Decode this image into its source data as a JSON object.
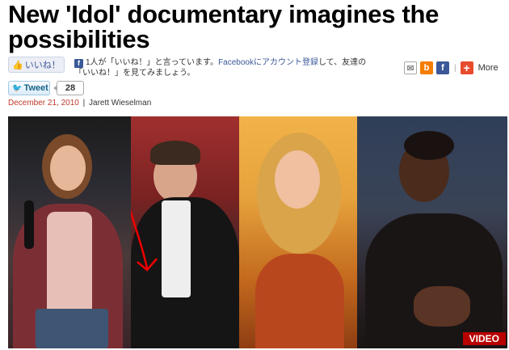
{
  "article": {
    "headline": "New 'Idol' documentary imagines the possibilities",
    "date": "December 21, 2010",
    "author": "Jarett Wieselman"
  },
  "social": {
    "like_label": "いいね！",
    "fb_text_count": "1人が「いいね！」と言っています。",
    "fb_text_link": "Facebookにアカウント登録",
    "fb_text_rest": "して、友達の「いいね！」を見てみましょう。",
    "tweet_label": "Tweet",
    "tweet_count": "28",
    "more_label": "More",
    "icons": [
      "mail-icon",
      "blogger-icon",
      "facebook-icon",
      "plus-icon"
    ]
  },
  "photo": {
    "badge": "VIDEO"
  },
  "colors": {
    "date": "#c0392b",
    "facebook": "#3b5998",
    "twitter": "#2aa4de",
    "video_badge": "#b80000"
  }
}
